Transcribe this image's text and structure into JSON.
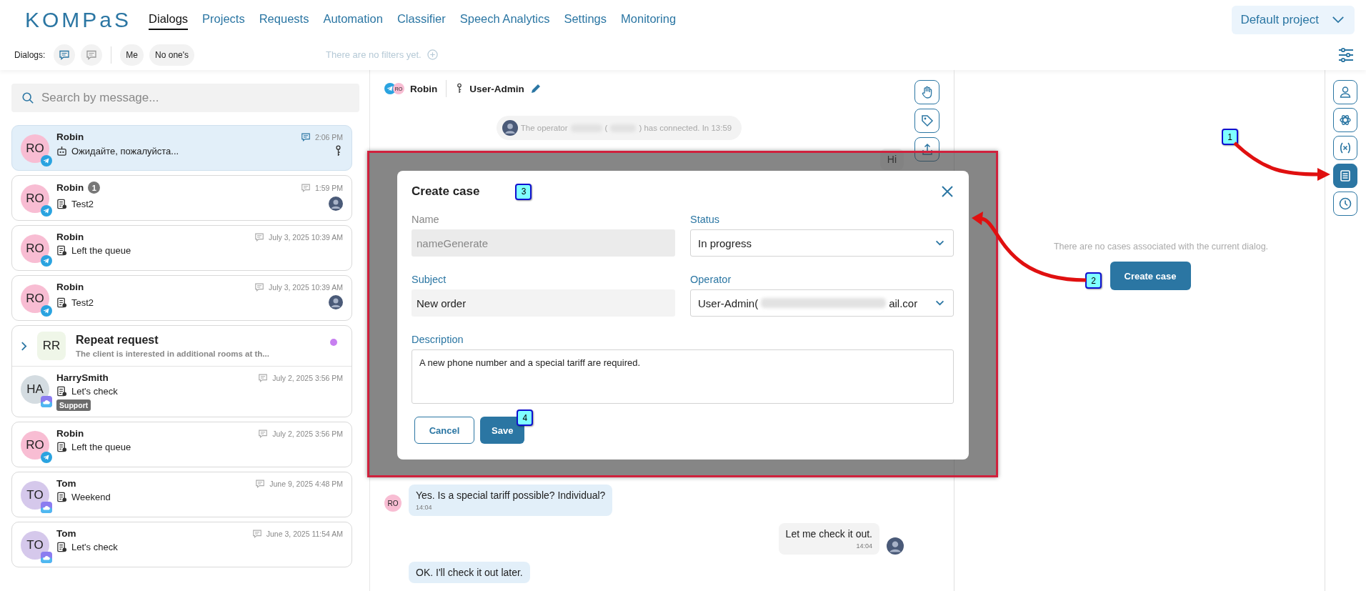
{
  "nav": {
    "logo": "KOMPaS",
    "items": [
      {
        "label": "Dialogs",
        "selected": true
      },
      {
        "label": "Projects",
        "selected": false
      },
      {
        "label": "Requests",
        "selected": false
      },
      {
        "label": "Automation",
        "selected": false
      },
      {
        "label": "Classifier",
        "selected": false
      },
      {
        "label": "Speech Analytics",
        "selected": false
      },
      {
        "label": "Settings",
        "selected": false
      },
      {
        "label": "Monitoring",
        "selected": false
      }
    ],
    "project": "Default project"
  },
  "filters": {
    "label": "Dialogs:",
    "view_buttons": [
      {
        "selected": true
      },
      {
        "selected": false
      }
    ],
    "chips": [
      "Me",
      "No one's"
    ],
    "empty": "There are no filters yet."
  },
  "search": {
    "placeholder": "Search by message..."
  },
  "dialogs": [
    {
      "kind": "dialog",
      "initials": "RO",
      "color": "#f8bdd3",
      "channel": {
        "kind": "telegram"
      },
      "name": "Robin",
      "time": "2:06 PM",
      "preview": {
        "kind": "bot"
      },
      "message": "Ожидайте, пожалуйста...",
      "assignee": {
        "kind": "figure"
      },
      "selected": true
    },
    {
      "kind": "dialog",
      "initials": "RO",
      "color": "#f8bdd3",
      "channel": {
        "kind": "telegram"
      },
      "name": "Robin",
      "unread": "1",
      "time": "1:59 PM",
      "preview": {
        "kind": "case"
      },
      "message": "Test2",
      "assignee": {
        "kind": "avatar"
      },
      "selected": false
    },
    {
      "kind": "dialog",
      "initials": "RO",
      "color": "#f8bdd3",
      "channel": {
        "kind": "telegram"
      },
      "name": "Robin",
      "time": "July 3, 2025 10:39 AM",
      "preview": {
        "kind": "case"
      },
      "message": "Left the queue",
      "selected": false
    },
    {
      "kind": "dialog",
      "initials": "RO",
      "color": "#f8bdd3",
      "channel": {
        "kind": "telegram"
      },
      "name": "Robin",
      "time": "July 3, 2025 10:39 AM",
      "preview": {
        "kind": "case"
      },
      "message": "Test2",
      "assignee": {
        "kind": "avatar"
      },
      "selected": false
    },
    {
      "kind": "group",
      "initials": "RR",
      "color": "#eff6e8",
      "title": "Repeat request",
      "subtitle": "The client is interested in additional rooms at th...",
      "dot": {
        "color": "#c77ff0"
      },
      "children": [
        {
          "kind": "dialog",
          "initials": "HA",
          "color": "#d4dce1",
          "channel": {
            "kind": "cloud"
          },
          "name": "HarrySmith",
          "time": "July 2, 2025 3:56 PM",
          "preview": {
            "kind": "case"
          },
          "message": "Let's check",
          "tag": "Support",
          "selected": false
        }
      ]
    },
    {
      "kind": "dialog",
      "initials": "RO",
      "color": "#f8bdd3",
      "channel": {
        "kind": "telegram"
      },
      "name": "Robin",
      "time": "July 2, 2025 3:56 PM",
      "preview": {
        "kind": "case"
      },
      "message": "Left the queue",
      "selected": false
    },
    {
      "kind": "dialog",
      "initials": "TO",
      "color": "#d5c8eb",
      "channel": {
        "kind": "cloud"
      },
      "name": "Tom",
      "time": "June 9, 2025 4:48 PM",
      "preview": {
        "kind": "case"
      },
      "message": "Weekend",
      "selected": false
    },
    {
      "kind": "dialog",
      "initials": "TO",
      "color": "#d5c8eb",
      "channel": {
        "kind": "cloud"
      },
      "name": "Tom",
      "time": "June 3, 2025 11:54 AM",
      "preview": {
        "kind": "case"
      },
      "message": "Let's check",
      "selected": false
    }
  ],
  "chat": {
    "channel": {
      "kind": "telegram"
    },
    "initials": "RO",
    "name": "Robin",
    "operator": "User-Admin",
    "system": [
      "The operator",
      "(",
      ") has connected. In 13:59"
    ],
    "actions": [
      {
        "kind": "hand"
      },
      {
        "kind": "tag"
      },
      {
        "kind": "share"
      }
    ],
    "messages": [
      {
        "kind": "out",
        "text": "Hi"
      },
      {
        "kind": "in",
        "initials": "RO",
        "text": "Yes. Is a special tariff possible? Individual?",
        "time": "14:04"
      },
      {
        "kind": "out",
        "text": "Let me check it out.",
        "time": "14:04",
        "avatar": true
      },
      {
        "kind": "in",
        "text": "OK. I'll check it out later."
      }
    ]
  },
  "cases": {
    "empty": "There are no cases associated with the current dialog.",
    "button": "Create case"
  },
  "side_tabs": [
    {
      "kind": "person",
      "selected": false
    },
    {
      "kind": "ai",
      "selected": false
    },
    {
      "kind": "variable",
      "selected": false
    },
    {
      "kind": "cases",
      "selected": true
    },
    {
      "kind": "history",
      "selected": false
    }
  ],
  "modal": {
    "title": "Create case",
    "fields": [
      {
        "label": "Name",
        "kind": "text",
        "value": "nameGenerate",
        "disabled": true
      },
      {
        "label": "Status",
        "kind": "select",
        "value": "In progress",
        "disabled": false
      },
      {
        "label": "Subject",
        "kind": "text",
        "value": "New order",
        "disabled": false
      },
      {
        "label": "Operator",
        "kind": "select",
        "value": "User-Admin(",
        "value_tail": "ail.cor",
        "disabled": false
      },
      {
        "label": "Description",
        "kind": "textarea",
        "value": "A new phone number and a special tariff are required.",
        "disabled": false
      }
    ],
    "buttons": [
      {
        "label": "Cancel",
        "kind": "secondary"
      },
      {
        "label": "Save",
        "kind": "primary"
      }
    ]
  },
  "steps": [
    "1",
    "2",
    "3",
    "4"
  ]
}
